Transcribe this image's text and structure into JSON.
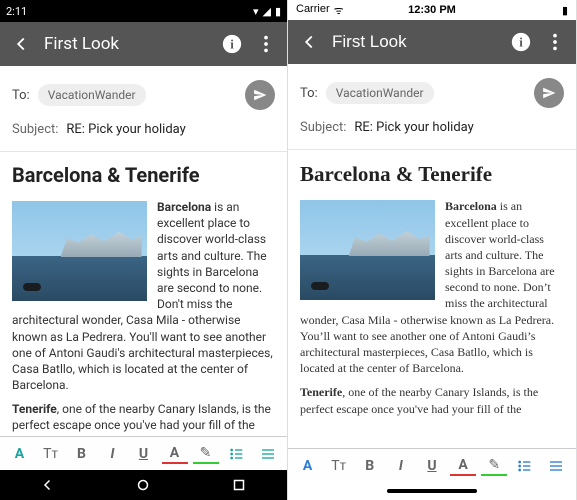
{
  "android": {
    "status": {
      "time": "2:11",
      "wifi": "▾",
      "signal": "◢",
      "battery": "▮"
    }
  },
  "ios": {
    "status": {
      "carrier": "Carrier",
      "wifi": "᯾",
      "time": "12:30 PM",
      "battery": "▮"
    }
  },
  "header": {
    "title": "First Look",
    "back_icon": "‹",
    "info_icon": "i",
    "more_icon": "⋮"
  },
  "compose": {
    "to_label": "To:",
    "recipient": "VacationWander",
    "send_icon": "➤",
    "subject_label": "Subject:",
    "subject_value": "RE: Pick your holiday"
  },
  "body": {
    "title": "Barcelona & Tenerife",
    "p1_bold": "Barcelona",
    "p1_android": " is an excellent place to discover world-class arts and culture. The sights in Barcelona are second to none. Don't miss the architectural wonder, Casa Mila - otherwise known as La Pedrera. You'll want to see another one of Antoni Gaudi's architectural masterpieces, Casa Batllo, which is located at the center of Barcelona.",
    "p1_ios": " is an excellent place to discover world-class arts and culture. The sights in Barcelona are second to none. Don’t miss the architectural wonder, Casa Mila - otherwise known as La Pedrera. You’ll want to see another one of Antoni Gaudi’s architectural masterpieces, Casa Batllo, which is located at the center of Barcelona.",
    "p2_bold": "Tenerife",
    "p2_android": ", one of the nearby Canary Islands, is the perfect escape once you've had your fill of the city.",
    "p2_ios": ", one of the nearby Canary Islands, is the perfect escape once you've had your fill of the"
  },
  "toolbar": {
    "font": "A",
    "size": "Tᴛ",
    "bold": "B",
    "italic": "I",
    "underline": "U",
    "color": "A",
    "highlight": "✎",
    "list": "≣",
    "align": "≡"
  }
}
